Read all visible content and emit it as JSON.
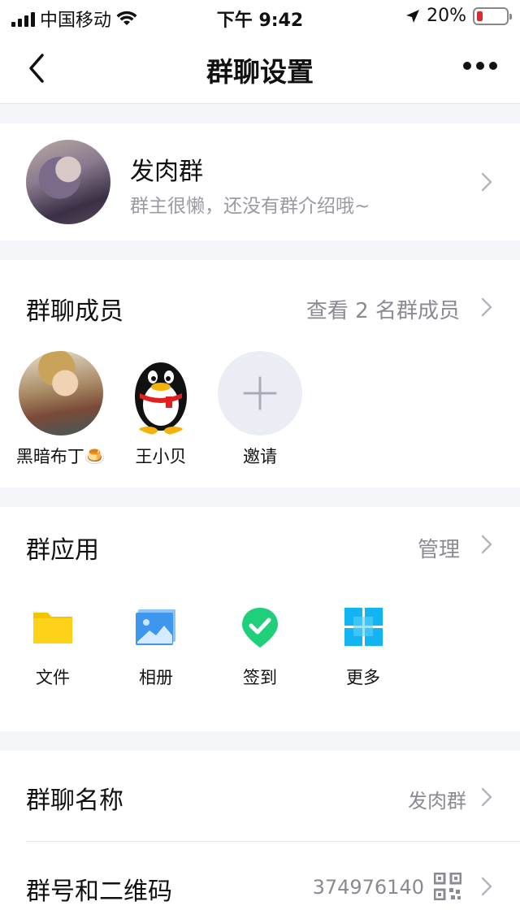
{
  "status_bar": {
    "carrier": "中国移动",
    "time": "下午 9:42",
    "battery": "20%",
    "battery_level": 0.2
  },
  "nav": {
    "title": "群聊设置"
  },
  "group": {
    "name": "发肉群",
    "description": "群主很懒，还没有群介绍哦~"
  },
  "members": {
    "title": "群聊成员",
    "view_all": "查看 2 名群成员",
    "list": [
      {
        "name": "黑暗布丁🍮"
      },
      {
        "name": "王小贝"
      }
    ],
    "invite_label": "邀请"
  },
  "apps": {
    "title": "群应用",
    "manage": "管理",
    "items": [
      {
        "label": "文件",
        "icon": "folder-icon"
      },
      {
        "label": "相册",
        "icon": "album-icon"
      },
      {
        "label": "签到",
        "icon": "checkin-icon"
      },
      {
        "label": "更多",
        "icon": "more-grid-icon"
      }
    ]
  },
  "settings": {
    "group_name_title": "群聊名称",
    "group_name_value": "发肉群",
    "group_id_title": "群号和二维码",
    "group_id_value": "374976140"
  }
}
